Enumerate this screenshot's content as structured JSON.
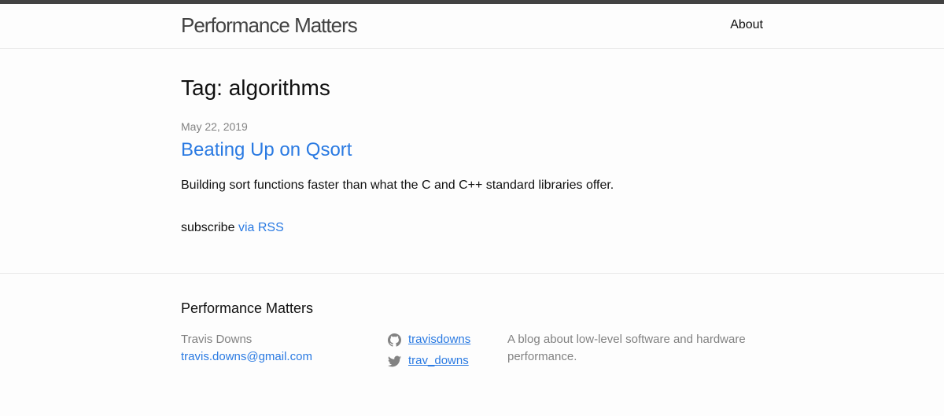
{
  "header": {
    "site_title": "Performance Matters",
    "nav": {
      "about_label": "About"
    }
  },
  "main": {
    "page_heading": "Tag: algorithms",
    "posts": [
      {
        "date": "May 22, 2019",
        "title": "Beating Up on Qsort",
        "excerpt": "Building sort functions faster than what the C and C++ standard libraries offer."
      }
    ],
    "subscribe": {
      "prefix": "subscribe",
      "link_label": "via RSS"
    }
  },
  "footer": {
    "heading": "Performance Matters",
    "author_name": "Travis Downs",
    "email": "travis.downs@gmail.com",
    "social": [
      {
        "icon": "github-icon",
        "label": "travisdowns"
      },
      {
        "icon": "twitter-icon",
        "label": "trav_downs"
      }
    ],
    "description": "A blog about low-level software and hardware performance."
  },
  "colors": {
    "link": "#2a7ae2",
    "text": "#111111",
    "muted": "#828282",
    "topbar": "#424242",
    "background": "#fdfdfd"
  }
}
